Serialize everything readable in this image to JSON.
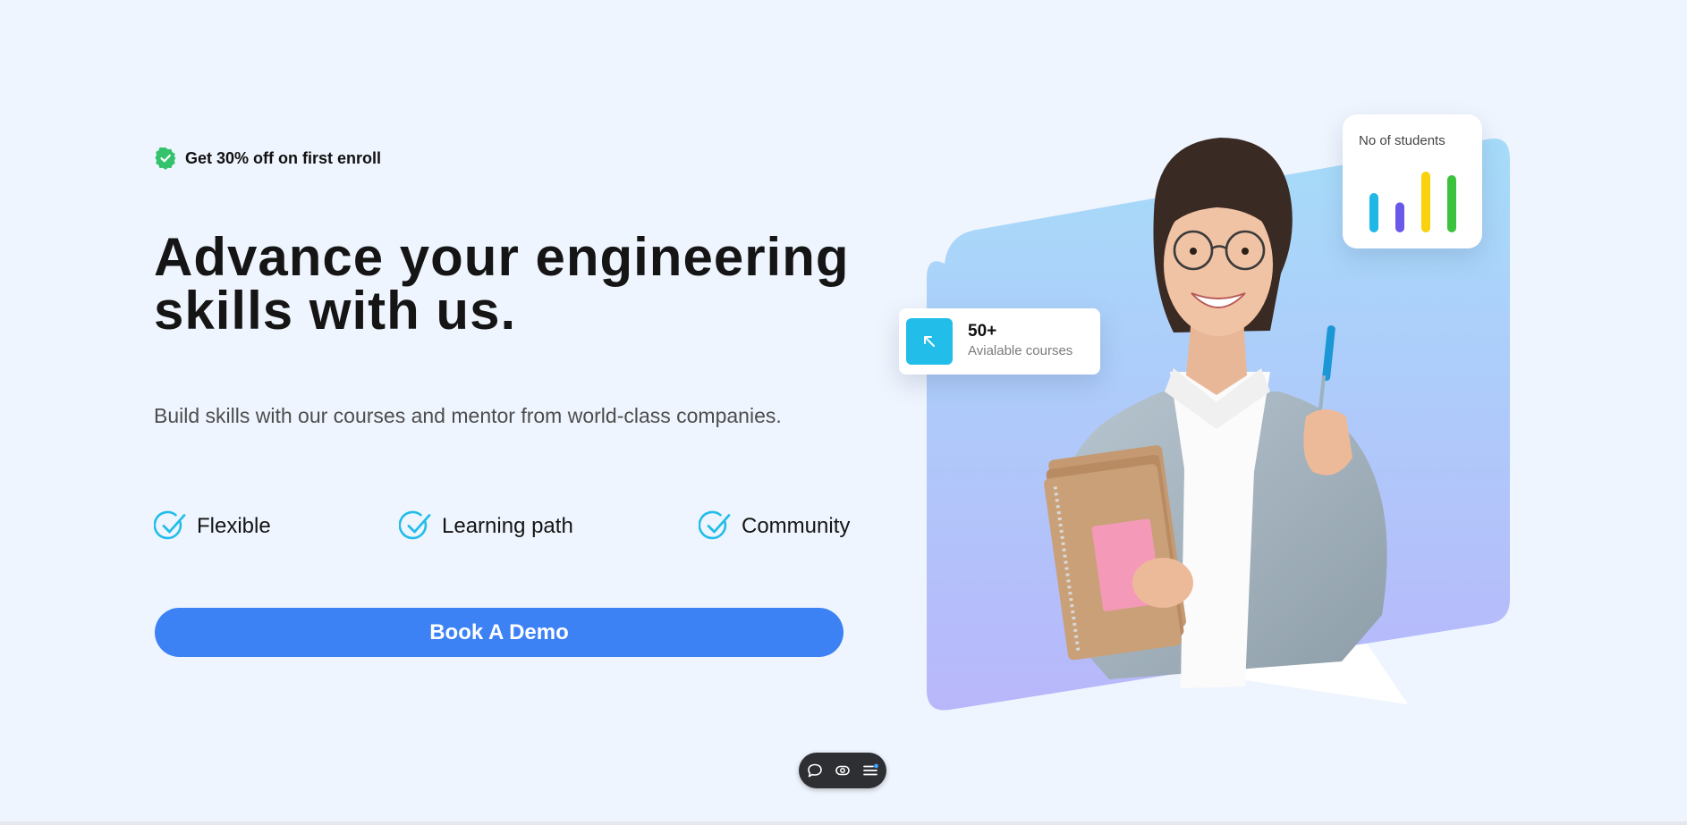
{
  "promo": {
    "text": "Get 30% off on first enroll",
    "icon": "verified-badge-icon",
    "icon_color": "#34c26c"
  },
  "hero": {
    "headline_line1": "Advance your engineering",
    "headline_line2": "skills with us.",
    "subline": "Build skills with our courses and mentor from world-class companies."
  },
  "features": [
    {
      "label": "Flexible",
      "icon": "check-circle-icon"
    },
    {
      "label": "Learning path",
      "icon": "check-circle-icon"
    },
    {
      "label": "Community",
      "icon": "check-circle-icon"
    }
  ],
  "cta": {
    "label": "Book A Demo",
    "color": "#3c82f4"
  },
  "courses_card": {
    "count": "50+",
    "label": "Avialable courses",
    "icon": "arrow-up-left-icon",
    "icon_bg": "#22bde9"
  },
  "students_card": {
    "title": "No of students",
    "bars": [
      {
        "value": 0.55,
        "color": "#1fb7e6"
      },
      {
        "value": 0.42,
        "color": "#6a58e8"
      },
      {
        "value": 0.85,
        "color": "#f8d20c"
      },
      {
        "value": 0.8,
        "color": "#3cc23c"
      }
    ]
  },
  "toolbar": {
    "items": [
      {
        "icon": "comment-icon"
      },
      {
        "icon": "eye-icon"
      },
      {
        "icon": "menu-icon"
      }
    ]
  }
}
